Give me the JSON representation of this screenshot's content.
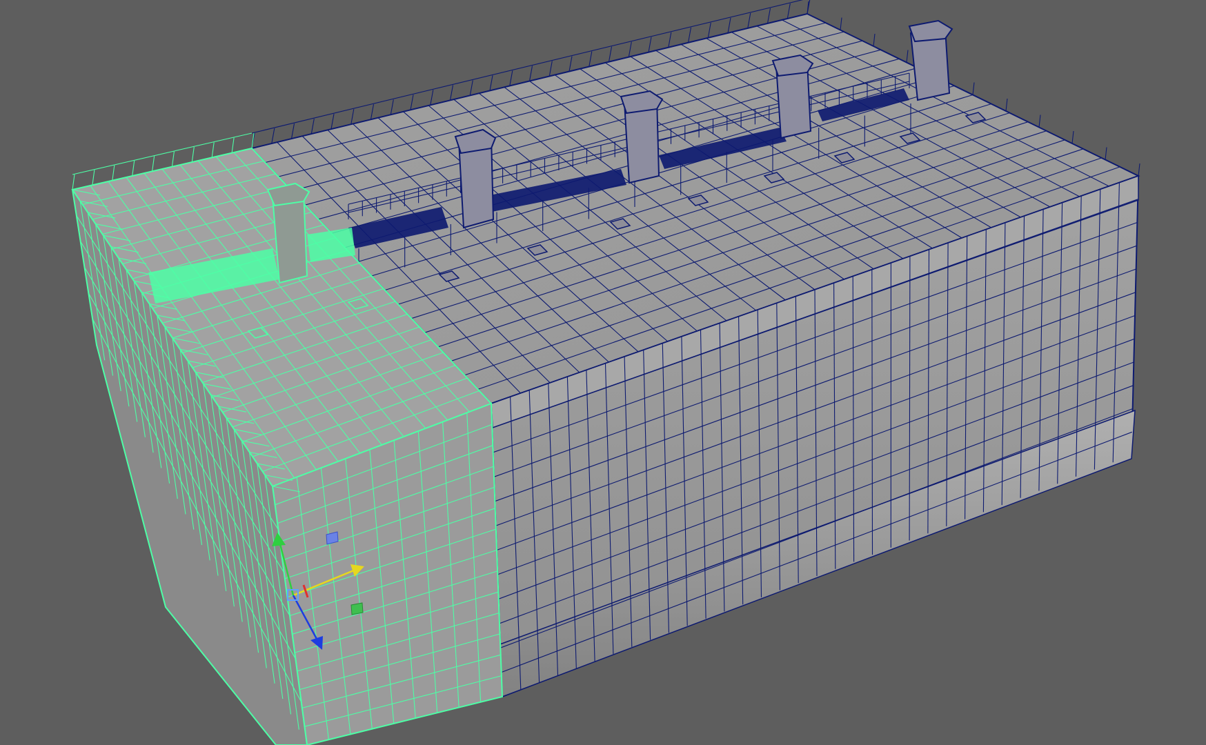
{
  "viewport": {
    "background": "#5e5e5e",
    "shaded_surface": "#9c9c9c",
    "wireframe_color": "#0d1a70",
    "selection_color": "#4dffa6"
  },
  "scene": {
    "object": "ship-hull-section-model",
    "selected_part": "bow-end-block"
  },
  "manipulator": {
    "type": "move-tool",
    "axis_colors": {
      "x": "#e6d71e",
      "y": "#2fcf40",
      "z": "#1d3de0",
      "center": "#5fa0ff"
    },
    "icons": [
      "move-x-arrow-icon",
      "move-y-arrow-icon",
      "move-z-arrow-icon",
      "move-center-handle-icon"
    ]
  }
}
